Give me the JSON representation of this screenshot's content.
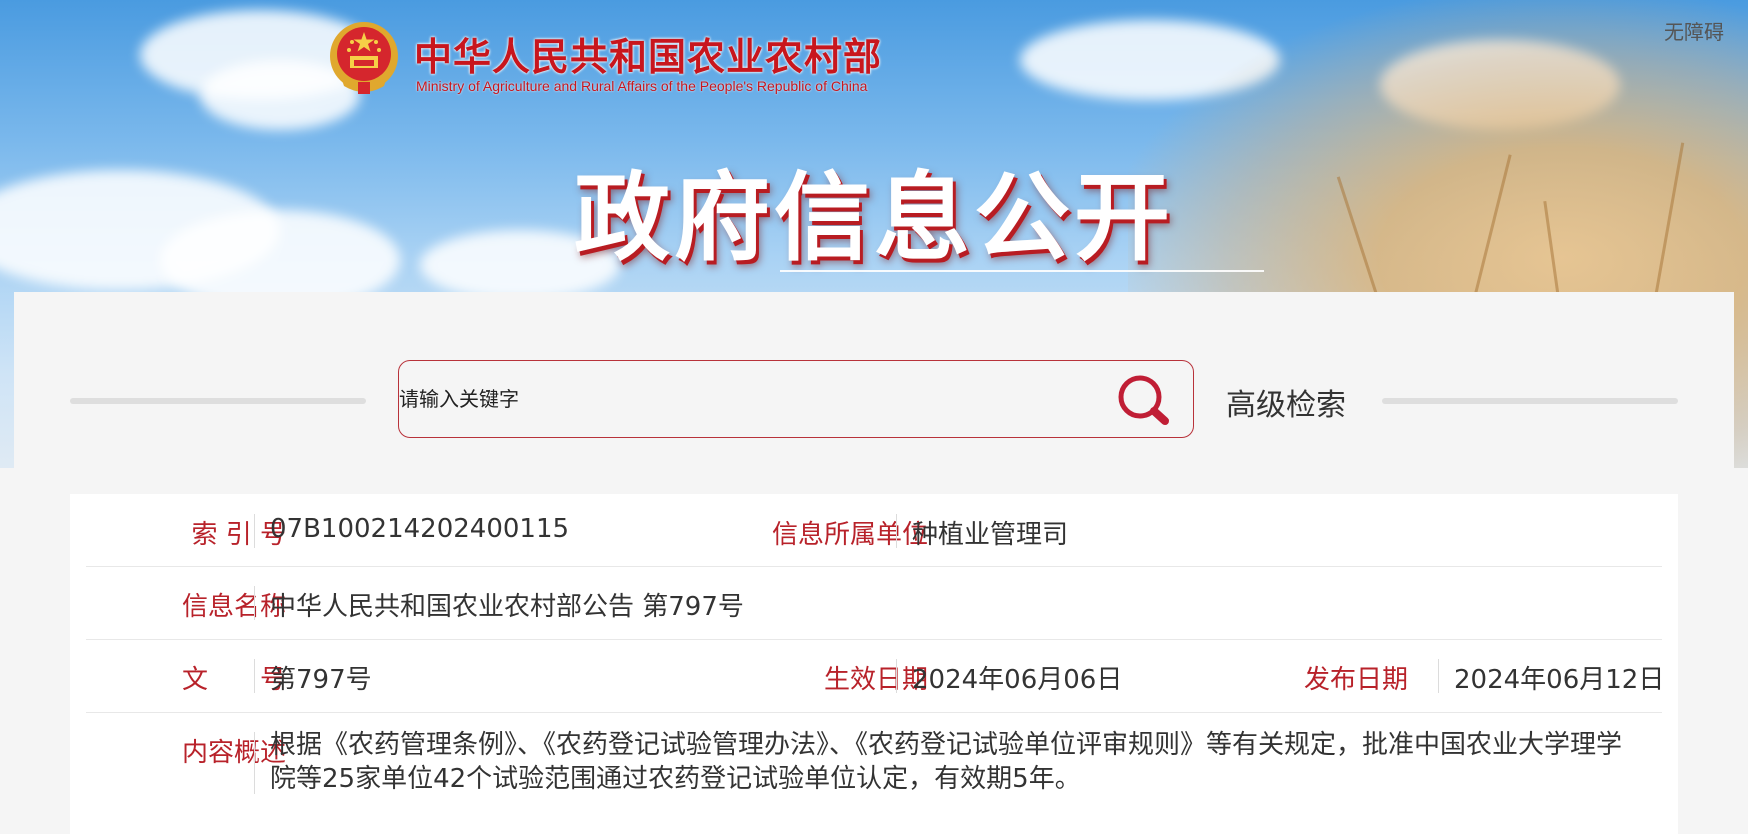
{
  "header": {
    "ministry_cn": "中华人民共和国农业农村部",
    "ministry_en": "Ministry of Agriculture and Rural Affairs of the People's Republic of China",
    "accessibility_label": "无障碍",
    "banner_title": "政府信息公开"
  },
  "search": {
    "placeholder": "请输入关键字",
    "advanced_label": "高级检索",
    "icon": "search-icon"
  },
  "info": {
    "index_label": "索 引 号",
    "index_value": "07B100214202400115",
    "unit_label": "信息所属单位",
    "unit_value": "种植业管理司",
    "name_label": "信息名称",
    "name_value": "中华人民共和国农业农村部公告 第797号",
    "doc_label": "文　　号",
    "doc_value": "第797号",
    "effective_label": "生效日期",
    "effective_value": "2024年06月06日",
    "publish_label": "发布日期",
    "publish_value": "2024年06月12日",
    "summary_label": "内容概述",
    "summary_value": "根据《农药管理条例》、《农药登记试验管理办法》、《农药登记试验单位评审规则》等有关规定，批准中国农业大学理学院等25家单位42个试验范围通过农药登记试验单位认定，有效期5年。"
  },
  "colors": {
    "accent_red": "#b8222a",
    "logo_red": "#c8161d",
    "sky_blue": "#4a9be0"
  }
}
